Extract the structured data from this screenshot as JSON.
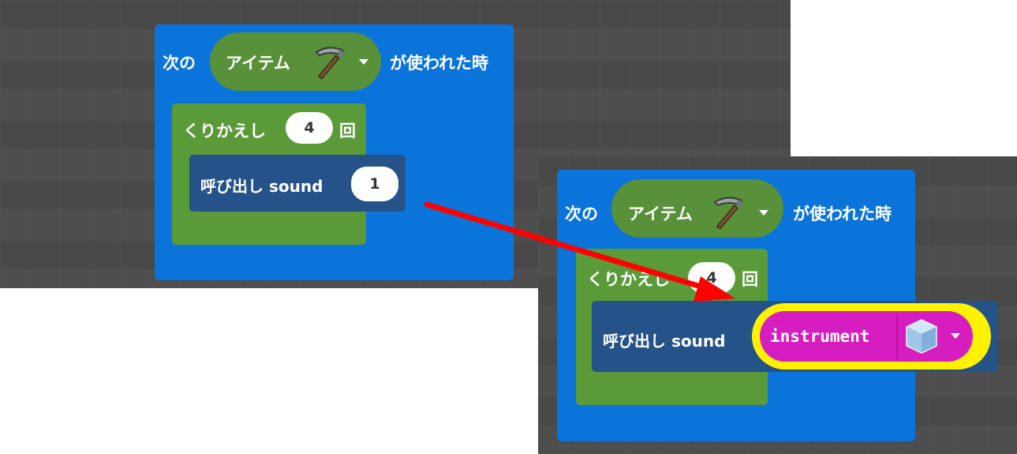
{
  "colors": {
    "event_blue": "#0a74da",
    "loop_green": "#5a9a39",
    "item_green": "#59903a",
    "call_navy": "#245289",
    "instrument_magenta": "#d61ec0",
    "highlight_yellow": "#fff200",
    "arrow_red": "#ff0000",
    "workspace_gray": "#4e4e4e"
  },
  "before": {
    "event_prefix": "次の",
    "item_label": "アイテム",
    "item_icon": "pickaxe-icon",
    "event_suffix": "が使われた時",
    "repeat_label": "くりかえし",
    "repeat_count": "4",
    "repeat_unit": "回",
    "call_label": "呼び出し sound",
    "call_arg": "1"
  },
  "after": {
    "event_prefix": "次の",
    "item_label": "アイテム",
    "item_icon": "pickaxe-icon",
    "event_suffix": "が使われた時",
    "repeat_label": "くりかえし",
    "repeat_count": "4",
    "repeat_unit": "回",
    "call_label": "呼び出し sound",
    "instrument_label": "instrument",
    "instrument_icon": "glass-block-icon"
  }
}
